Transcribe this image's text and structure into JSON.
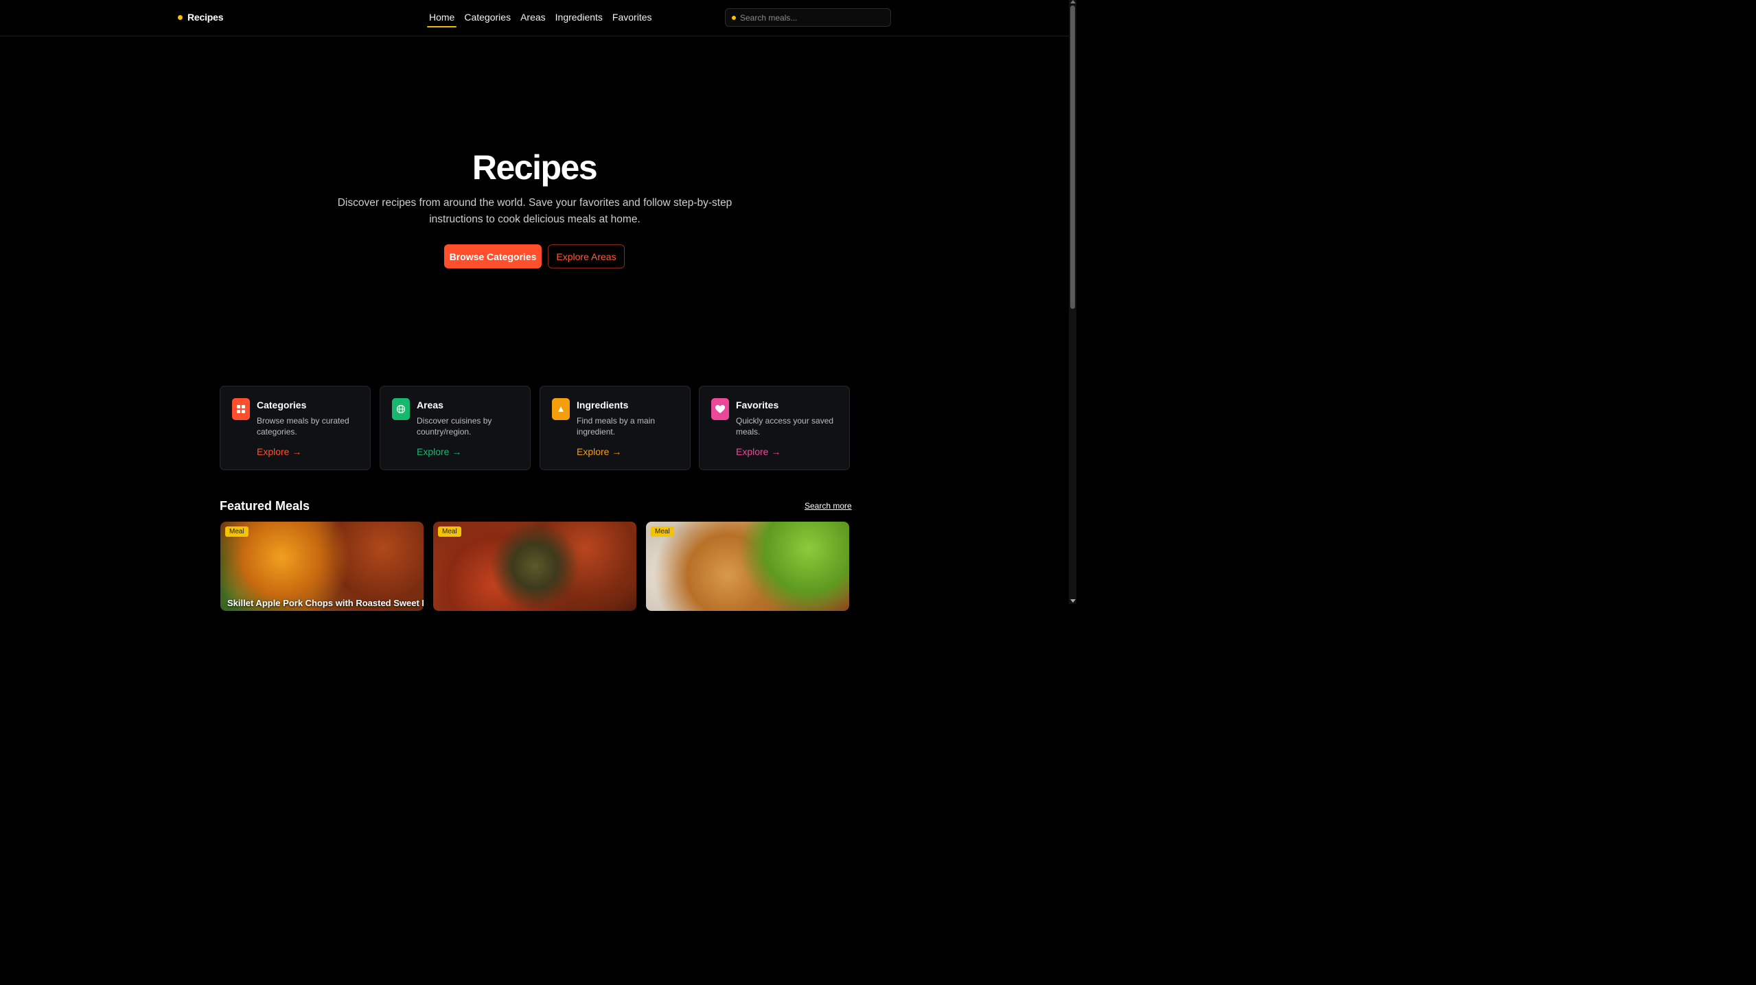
{
  "nav": {
    "brand": "Recipes",
    "items": [
      {
        "label": "Home",
        "active": true
      },
      {
        "label": "Categories",
        "active": false
      },
      {
        "label": "Areas",
        "active": false
      },
      {
        "label": "Ingredients",
        "active": false
      },
      {
        "label": "Favorites",
        "active": false
      }
    ],
    "search_placeholder": "Search meals..."
  },
  "hero": {
    "title": "Recipes",
    "subtitle": "Discover recipes from around the world. Save your favorites and follow step-by-step instructions to cook delicious meals at home.",
    "primary_button": "Browse Categories",
    "secondary_button": "Explore Areas"
  },
  "features": [
    {
      "title": "Categories",
      "desc": "Browse meals by curated categories.",
      "link": "Explore →",
      "color": "#ff4f2d",
      "icon": "grid-icon"
    },
    {
      "title": "Areas",
      "desc": "Discover cuisines by country/region.",
      "link": "Explore →",
      "color": "#16b86f",
      "icon": "globe-icon"
    },
    {
      "title": "Ingredients",
      "desc": "Find meals by a main ingredient.",
      "link": "Explore →",
      "color": "#f59e0b",
      "icon": "flask-icon"
    },
    {
      "title": "Favorites",
      "desc": "Quickly access your saved meals.",
      "link": "Explore →",
      "color": "#ec4899",
      "icon": "heart-icon"
    }
  ],
  "featured": {
    "title": "Featured Meals",
    "more": "Search more",
    "meals": [
      {
        "badge": "Meal",
        "name": "Skillet Apple Pork Chops with Roasted Sweet Potatoes & Zucchini"
      },
      {
        "badge": "Meal",
        "name": ""
      },
      {
        "badge": "Meal",
        "name": ""
      }
    ]
  }
}
